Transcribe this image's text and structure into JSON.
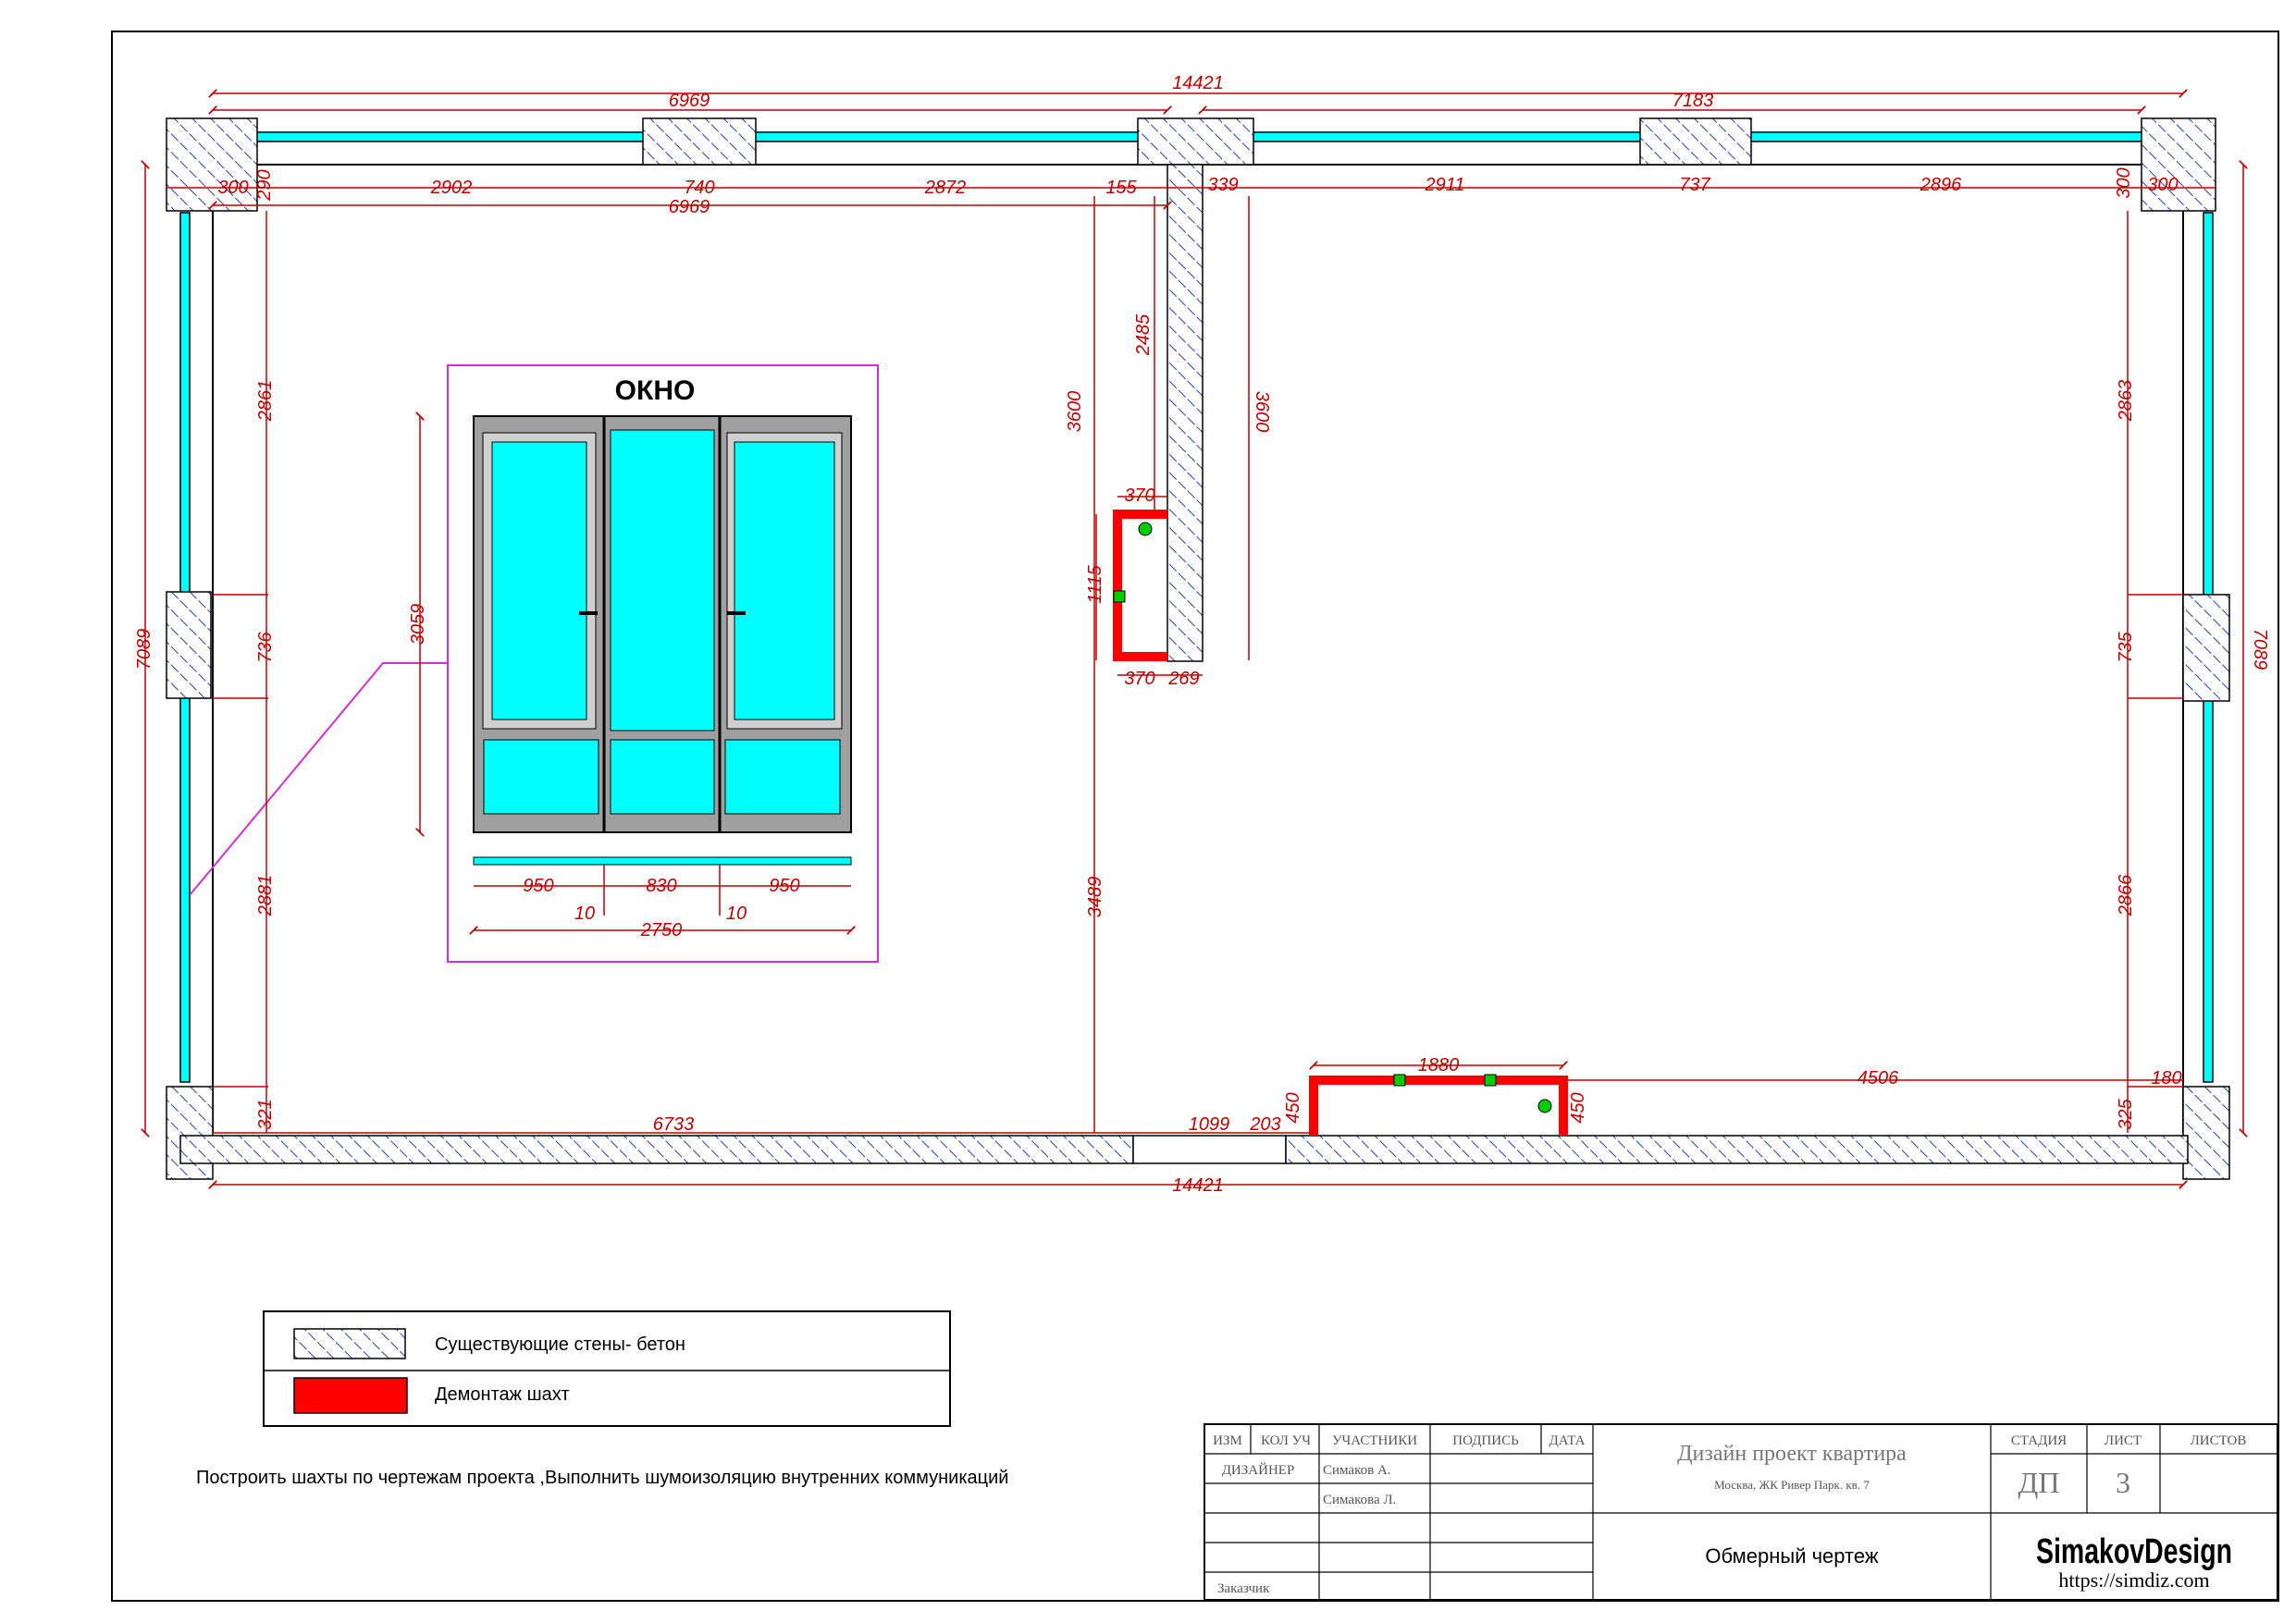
{
  "plan": {
    "window_label": "ОКНО",
    "dims": {
      "overall_top": "14421",
      "overall_bottom": "14421",
      "left_room_top": "6969",
      "left_room_inner": "6969",
      "right_room_top": "7183",
      "top_300_left": "300",
      "top_290": "290",
      "top_2902": "2902",
      "top_740": "740",
      "top_2872": "2872",
      "top_155": "155",
      "top_339": "339",
      "top_2911": "2911",
      "top_737": "737",
      "top_2896": "2896",
      "top_300_right_v": "300",
      "top_300_right": "300",
      "left_height": "7089",
      "right_height": "7089",
      "left_2861": "2861",
      "left_736": "736",
      "left_2881": "2881",
      "left_321": "321",
      "right_2863": "2863",
      "right_735": "735",
      "right_2866": "2866",
      "right_325": "325",
      "right_180": "180",
      "right_4506": "4506",
      "partition_3600_left": "3600",
      "partition_3600_right": "3600",
      "partition_2485": "2485",
      "partition_3489": "3489",
      "shaft_370_top": "370",
      "shaft_1115": "1115",
      "shaft_370_bottom": "370",
      "shaft_269": "269",
      "bottom_6733": "6733",
      "bottom_1099": "1099",
      "bottom_203": "203",
      "shaft2_1880": "1880",
      "shaft2_450_left": "450",
      "shaft2_450_right": "450",
      "win_3059": "3059",
      "win_950_left": "950",
      "win_830": "830",
      "win_950_right": "950",
      "win_10_left": "10",
      "win_10_right": "10",
      "win_2750": "2750"
    }
  },
  "legend": {
    "items": [
      {
        "label": "Существующие стены- бетон",
        "swatch": "hatch-blue"
      },
      {
        "label": "Демонтаж шахт",
        "swatch": "red"
      }
    ]
  },
  "note": "Построить шахты по чертежам проекта ,Выполнить шумоизоляцию внутренних коммуникаций",
  "title_block": {
    "headers": [
      "ИЗМ",
      "КОЛ УЧ",
      "УЧАСТНИКИ",
      "ПОДПИСЬ",
      "ДАТА"
    ],
    "role": "ДИЗАЙНЕР",
    "participants": [
      "Симаков А.",
      "Симакова Л."
    ],
    "client_label": "Заказчик",
    "project_title": "Дизайн проект квартира",
    "address": "Москва, ЖК Ривер Парк. кв. 7",
    "sheet_title": "Обмерный чертеж",
    "stage_header": "СТАДИЯ",
    "sheet_header": "ЛИСТ",
    "sheets_header": "ЛИСТОВ",
    "stage": "ДП",
    "sheet_number": "3",
    "brand": "SimakovDesign",
    "url": "https://simdiz.com"
  },
  "colors": {
    "dimension": "#c00000",
    "glass": "#00ffff",
    "demolition": "#ff0000",
    "hatch": "#2b3da8",
    "window_frame": "#a0a0a0",
    "window_callout": "#d030d0"
  }
}
